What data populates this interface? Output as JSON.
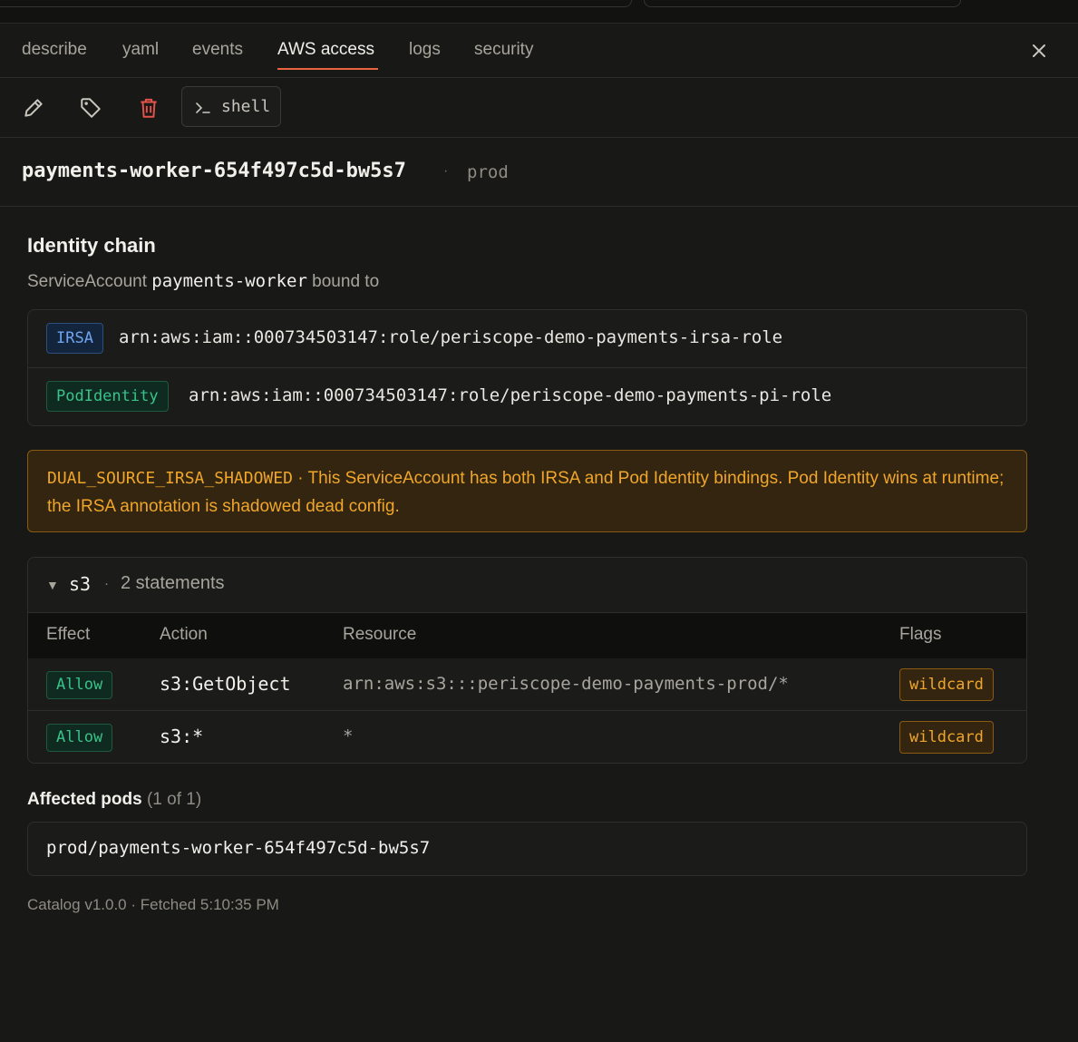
{
  "tabs": [
    {
      "label": "describe",
      "active": false
    },
    {
      "label": "yaml",
      "active": false
    },
    {
      "label": "events",
      "active": false
    },
    {
      "label": "AWS access",
      "active": true
    },
    {
      "label": "logs",
      "active": false
    },
    {
      "label": "security",
      "active": false
    }
  ],
  "toolbar": {
    "shell_label": "shell",
    "icons": [
      "pencil-icon",
      "tag-icon",
      "trash-icon",
      "terminal-prompt-icon"
    ]
  },
  "pod": {
    "name": "payments-worker-654f497c5d-bw5s7",
    "separator": "·",
    "namespace": "prod"
  },
  "identity": {
    "heading": "Identity chain",
    "sa_prefix": "ServiceAccount",
    "sa_name": "payments-worker",
    "sa_suffix": "bound to",
    "bindings": [
      {
        "type": "IRSA",
        "arn": "arn:aws:iam::000734503147:role/periscope-demo-payments-irsa-role"
      },
      {
        "type": "PodIdentity",
        "arn": "arn:aws:iam::000734503147:role/periscope-demo-payments-pi-role"
      }
    ]
  },
  "warning": {
    "code": "DUAL_SOURCE_IRSA_SHADOWED",
    "separator": " · ",
    "message": "This ServiceAccount has both IRSA and Pod Identity bindings. Pod Identity wins at runtime; the IRSA annotation is shadowed dead config."
  },
  "policy": {
    "service": "s3",
    "separator": "·",
    "statement_count": "2 statements",
    "columns": {
      "effect": "Effect",
      "action": "Action",
      "resource": "Resource",
      "flags": "Flags"
    },
    "rows": [
      {
        "effect": "Allow",
        "action": "s3:GetObject",
        "resource": "arn:aws:s3:::periscope-demo-payments-prod/*",
        "flag": "wildcard"
      },
      {
        "effect": "Allow",
        "action": "s3:*",
        "resource": "*",
        "flag": "wildcard"
      }
    ]
  },
  "affected": {
    "heading": "Affected pods",
    "count": "(1 of 1)",
    "pods": [
      "prod/payments-worker-654f497c5d-bw5s7"
    ]
  },
  "footer": {
    "text": "Catalog v1.0.0 · Fetched 5:10:35 PM"
  },
  "colors": {
    "background": "#181816",
    "accent_underline": "#e8643f",
    "danger_icon": "#e5534b",
    "irsa_blue": "#6fa5f0",
    "allow_green": "#39c38a",
    "warning_amber": "#f0a62a"
  }
}
